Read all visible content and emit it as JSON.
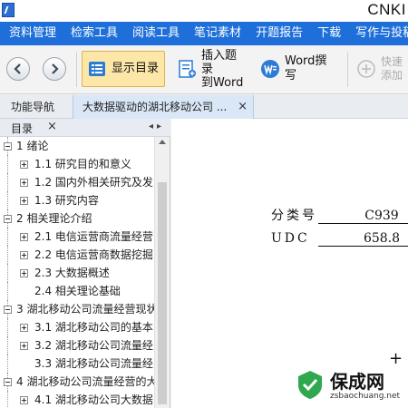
{
  "window": {
    "title": "CNKI"
  },
  "menu": [
    "资料管理",
    "检索工具",
    "阅读工具",
    "笔记素材",
    "开题报告",
    "下载",
    "写作与投稿",
    "工"
  ],
  "toolbar": {
    "show_toc": "显示目录",
    "insert_title_line1": "插入题录",
    "insert_title_line2": "到Word",
    "word_write": "Word撰写",
    "quick_add_line1": "快速",
    "quick_add_line2": "添加"
  },
  "tabs": {
    "nav": "功能导航",
    "doc": "大数据驱动的湖北移动公司 ...",
    "close": "×"
  },
  "toc_panel": {
    "title": "目录",
    "close": "×",
    "arrows": "◂▸",
    "items": [
      {
        "label": "1 绪论",
        "level": 1,
        "expanded": true
      },
      {
        "label": "1.1 研究目的和意义",
        "level": 2,
        "expanded": false
      },
      {
        "label": "1.2 国内外相关研究及发",
        "level": 2,
        "expanded": false
      },
      {
        "label": "1.3 研究内容",
        "level": 2,
        "expanded": false
      },
      {
        "label": "2 相关理论介绍",
        "level": 1,
        "expanded": true
      },
      {
        "label": "2.1 电信运营商流量经营",
        "level": 2,
        "expanded": false
      },
      {
        "label": "2.2 电信运营商数据挖掘",
        "level": 2,
        "expanded": false
      },
      {
        "label": "2.3 大数据概述",
        "level": 2,
        "expanded": false
      },
      {
        "label": "2.4 相关理论基础",
        "level": 2,
        "expanded": null
      },
      {
        "label": "3 湖北移动公司流量经营现状",
        "level": 1,
        "expanded": true
      },
      {
        "label": "3.1 湖北移动公司的基本",
        "level": 2,
        "expanded": false
      },
      {
        "label": "3.2 湖北移动公司流量经",
        "level": 2,
        "expanded": false
      },
      {
        "label": "3.3 湖北移动公司流量经",
        "level": 2,
        "expanded": null
      },
      {
        "label": "4 湖北移动公司流量经营的大",
        "level": 1,
        "expanded": true
      },
      {
        "label": "4.1 湖北移动公司大数据",
        "level": 2,
        "expanded": false
      }
    ]
  },
  "document": {
    "class_label": "分类号",
    "class_value": "C939",
    "udc_label": "UDC",
    "udc_value": "658.8",
    "mark": "+"
  },
  "watermark": {
    "name": "保成网",
    "url": "zsbaochuang.net"
  },
  "colors": {
    "menu_bg": "#1e6fd9",
    "active_btn": "#fde7a8",
    "tab_active": "#d9e7f7"
  }
}
